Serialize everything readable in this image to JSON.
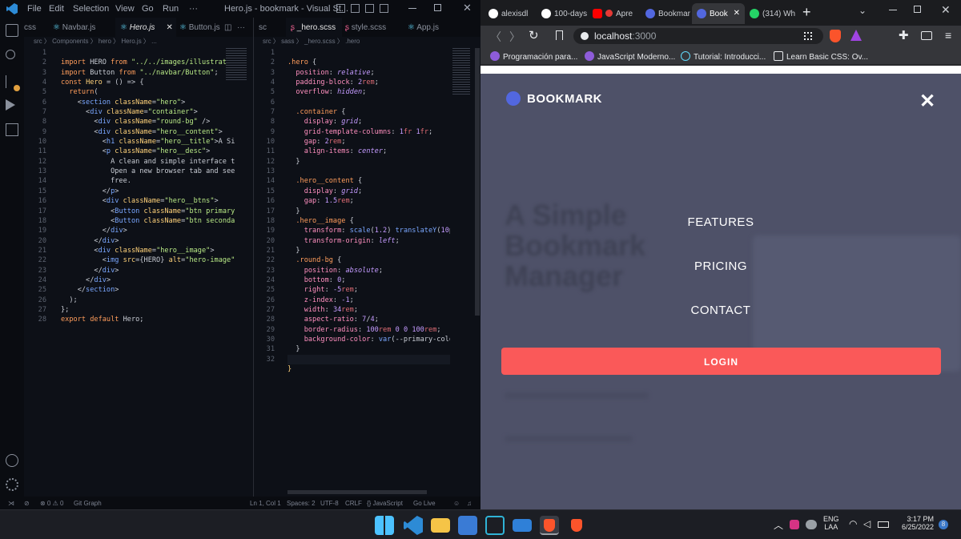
{
  "vscode": {
    "title": "Hero.js - bookmark - Visual St...",
    "menu": [
      "File",
      "Edit",
      "Selection",
      "View",
      "Go",
      "Run",
      "···"
    ],
    "left_tabs": [
      {
        "label": "css",
        "active": false
      },
      {
        "label": "Navbar.js",
        "active": false
      },
      {
        "label": "Hero.js",
        "active": true
      },
      {
        "label": "Button.js",
        "active": false
      }
    ],
    "right_tabs": [
      {
        "label": "sc",
        "active": false
      },
      {
        "label": "_hero.scss",
        "active": true
      },
      {
        "label": "style.scss",
        "active": false
      },
      {
        "label": "App.js",
        "active": false
      }
    ],
    "left_breadcrumb": "src 〉 Components 〉 hero 〉 Hero.js 〉 ...",
    "right_breadcrumb": "src 〉 sass 〉 _hero.scss 〉 .hero",
    "left_line_numbers": "1\n2\n3\n4\n5\n6\n7\n8\n9\n10\n11\n12\n13\n14\n15\n16\n17\n18\n19\n20\n21\n22\n23\n24\n25\n26\n27\n28",
    "right_line_numbers": "1\n2\n3\n4\n5\n6\n7\n8\n9\n10\n11\n12\n13\n14\n15\n16\n17\n18\n19\n20\n21\n22\n23\n24\n25\n26\n27\n28\n29\n30\n31\n32",
    "left_code": [
      "import HERO from \"../../images/illustrat",
      "import Button from \"../navbar/Button\";",
      "const Hero = () => {",
      "  return(",
      "    <section className=\"hero\">",
      "      <div className=\"container\">",
      "        <div className=\"round-bg\" />",
      "        <div className=\"hero__content\">",
      "          <h1 className=\"hero__title\">A Si",
      "          <p className=\"hero__desc\">",
      "            A clean and simple interface t",
      "            Open a new browser tab and see",
      "            free.",
      "          </p>",
      "          <div className=\"hero__btns\">",
      "            <Button className=\"btn primary",
      "            <Button className=\"btn seconda",
      "          </div>",
      "        </div>",
      "        <div className=\"hero__image\">",
      "          <img src={HERO} alt=\"hero-image\"",
      "        </div>",
      "      </div>",
      "    </section>",
      "  );",
      "};",
      "export default Hero;",
      ""
    ],
    "right_code": [
      ".hero {",
      "  position: relative;",
      "  padding-block: 2rem;",
      "  overflow: hidden;",
      "",
      "  .container {",
      "    display: grid;",
      "    grid-template-columns: 1fr 1fr;",
      "    gap: 2rem;",
      "    align-items: center;",
      "  }",
      "",
      "  .hero__content {",
      "    display: grid;",
      "    gap: 1.5rem;",
      "  }",
      "  .hero__image {",
      "    transform: scale(1.2) translateY(10p",
      "    transform-origin: left;",
      "  }",
      "  .round-bg {",
      "    position: absolute;",
      "    bottom: 0;",
      "    right: -5rem;",
      "    z-index: -1;",
      "    width: 34rem;",
      "    aspect-ratio: 7/4;",
      "    border-radius: 100rem 0 0 100rem;",
      "    background-color: var(--primary-colo",
      "  }",
      "",
      "}"
    ],
    "status_left": [
      "⊗ 0 ⚠ 0",
      "Git Graph"
    ],
    "status_right": [
      "Ln 1, Col 1",
      "Spaces: 2",
      "UTF-8",
      "CRLF",
      "{} JavaScript",
      "Go Live"
    ]
  },
  "browser": {
    "tabs": [
      {
        "label": "alexisdl",
        "icon": "github-icon",
        "active": false
      },
      {
        "label": "100-days",
        "icon": "github-icon",
        "active": false
      },
      {
        "label": "Apre",
        "icon": "youtube-icon",
        "active": false
      },
      {
        "label": "Bookmar",
        "icon": "bookmark-favicon",
        "active": false
      },
      {
        "label": "Book",
        "icon": "bookmark-favicon",
        "active": true
      },
      {
        "label": "(314) Wh",
        "icon": "whatsapp-icon",
        "active": false
      }
    ],
    "new_tab": "+",
    "url": "localhost:3000",
    "url_host": "localhost",
    "url_port": ":3000",
    "bookmarks": [
      {
        "label": "Programación para...",
        "color": "#8e5cd9"
      },
      {
        "label": "JavaScript Moderno...",
        "color": "#8e5cd9"
      },
      {
        "label": "Tutorial: Introducci...",
        "color": "#61dafb"
      },
      {
        "label": "Learn Basic CSS: Ov...",
        "color": "#e8eaed"
      }
    ],
    "page": {
      "brand": "BOOKMARK",
      "close": "✕",
      "nav": [
        "FEATURES",
        "PRICING",
        "CONTACT"
      ],
      "login": "LOGIN",
      "background_title": "A Simple Bookmark Manager",
      "colors": {
        "overlay": "#4e5168",
        "primary": "#5267df",
        "login": "#fa5959"
      }
    }
  },
  "taskbar": {
    "lang": "ENG",
    "region": "LAA",
    "time": "3:17 PM",
    "date": "6/25/2022",
    "notification_count": "8"
  }
}
